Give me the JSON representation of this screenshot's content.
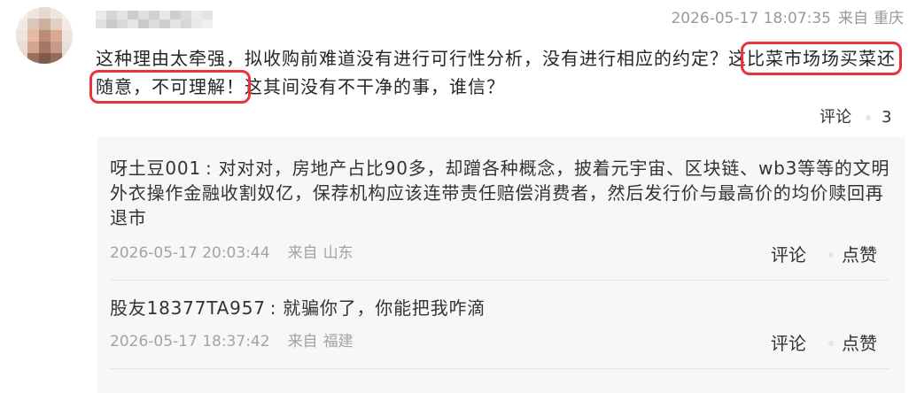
{
  "theme": {
    "highlight_color": "#e8333b",
    "reply_background": "#f7f7f7"
  },
  "comment": {
    "time": "2026-05-17 18:07:35",
    "from_label": "来自",
    "location": "重庆",
    "lines": [
      [
        {
          "text": "这种理由太牵强，拟收购前难道没有进行可行性分析，没有进行相应的约定？这",
          "highlighted": false
        },
        {
          "text": "比菜市场场买菜还",
          "highlighted": true
        }
      ],
      [
        {
          "text": "随意，不可理解！",
          "highlighted": true
        },
        {
          "text": "这其间没有不干净的事，谁信？",
          "highlighted": false
        }
      ]
    ],
    "actions": {
      "reply_label": "评论",
      "like_icon": "like-icon",
      "like_count": 3
    }
  },
  "replies": [
    {
      "author": "呀土豆001",
      "separator": ":",
      "lines": [
        "对对对，房地产占比90多，却蹭各种概念，披着元宇宙、区块链、wb3等等的文明",
        "外衣操作金融收割奴亿，保荐机构应该连带责任赔偿消费者，然后发行价与最高价的均价赎回再",
        "退市"
      ],
      "time": "2026-05-17 20:03:44",
      "from_label": "来自",
      "location": "山东",
      "actions": {
        "reply_label": "评论",
        "like_icon": "like-icon",
        "like_label": "点赞"
      }
    },
    {
      "author": "股友18377TA957",
      "separator": ":",
      "lines": [
        "就骗你了，你能把我咋滴"
      ],
      "time": "2026-05-17 18:37:42",
      "from_label": "来自",
      "location": "福建",
      "actions": {
        "reply_label": "评论",
        "like_icon": "like-icon",
        "like_label": "点赞"
      }
    }
  ]
}
